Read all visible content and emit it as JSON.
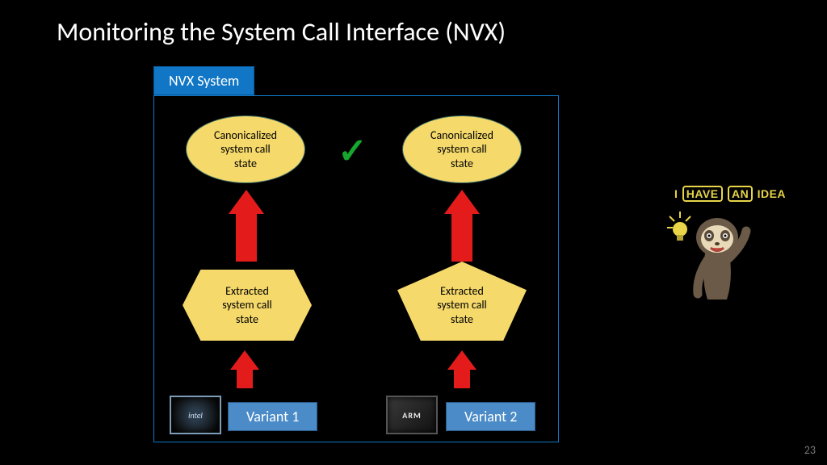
{
  "title": "Monitoring the System Call Interface (NVX)",
  "nvx_label": "NVX System",
  "ellipse_left": "Canonicalized\nsystem call\nstate",
  "ellipse_right": "Canonicalized\nsystem call\nstate",
  "hex_left": "Extracted\nsystem call\nstate",
  "pent_right": "Extracted\nsystem call\nstate",
  "chip_left": "intel",
  "chip_right": "ARM",
  "variant_left": "Variant 1",
  "variant_right": "Variant 2",
  "idea": {
    "w1": "I",
    "w2": "HAVE",
    "w3": "AN",
    "w4": "IDEA"
  },
  "slide_number": "23",
  "chart_data": {
    "type": "diagram",
    "title": "Monitoring the System Call Interface (NVX)",
    "container": "NVX System",
    "variants": [
      {
        "name": "Variant 1",
        "architecture": "Intel x86",
        "flow": [
          "Variant 1",
          "Extracted system call state",
          "Canonicalized system call state"
        ]
      },
      {
        "name": "Variant 2",
        "architecture": "ARM",
        "flow": [
          "Variant 2",
          "Extracted system call state",
          "Canonicalized system call state"
        ]
      }
    ],
    "comparison": "Canonicalized states are compared (checkmark = match)",
    "annotations": [
      "I HAVE AN IDEA (sloth character with lightbulb)"
    ]
  }
}
